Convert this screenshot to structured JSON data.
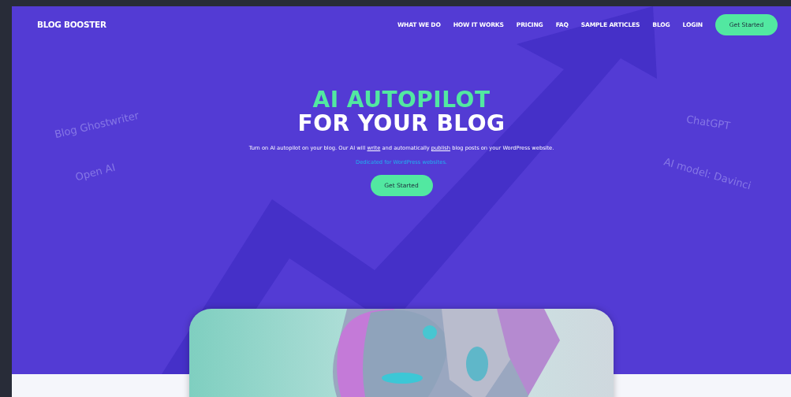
{
  "brand": "BLOG BOOSTER",
  "nav": [
    {
      "label": "WHAT WE DO"
    },
    {
      "label": "HOW IT WORKS"
    },
    {
      "label": "PRICING"
    },
    {
      "label": "FAQ"
    },
    {
      "label": "SAMPLE ARTICLES"
    },
    {
      "label": "BLOG"
    },
    {
      "label": "LOGIN"
    }
  ],
  "nav_button": "Get Started",
  "hero": {
    "title_line_1": "AI AUTOPILOT",
    "title_line_2": "FOR YOUR BLOG",
    "subtitle": [
      {
        "kind": "text",
        "text": "Turn on AI autopilot on your blog. Our AI will "
      },
      {
        "kind": "link",
        "text": "write"
      },
      {
        "kind": "text",
        "text": " and automatically "
      },
      {
        "kind": "link",
        "text": "publish"
      },
      {
        "kind": "text",
        "text": " blog posts on your WordPress website."
      }
    ],
    "note": "Dedicated for WordPress websites.",
    "button": "Get Started"
  },
  "left_tags": [
    "Blog Ghostwriter",
    "Open AI"
  ],
  "right_tags": [
    "ChatGPT",
    "AI model: Davinci"
  ]
}
